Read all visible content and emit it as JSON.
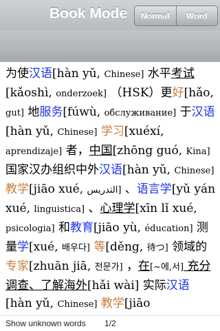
{
  "header": {
    "title": "Book Mode",
    "segments": [
      "Normal",
      "Word"
    ]
  },
  "content": {
    "tokens": [
      {
        "t": "为使",
        "c": ""
      },
      {
        "t": "汉语",
        "c": "blue"
      },
      {
        "t": "[hàn yǔ, ",
        "c": ""
      },
      {
        "t": "Chinese]",
        "c": "small"
      },
      {
        "t": " 水平",
        "c": ""
      },
      {
        "t": "考试",
        "c": "ul"
      },
      {
        "t": "[kǎoshì, ",
        "c": ""
      },
      {
        "t": "onderzoek]",
        "c": "small"
      },
      {
        "t": " （HSK）更",
        "c": ""
      },
      {
        "t": "好",
        "c": "orange"
      },
      {
        "t": "[hǎo, ",
        "c": ""
      },
      {
        "t": "gut]",
        "c": "small"
      },
      {
        "t": " 地",
        "c": ""
      },
      {
        "t": "服务",
        "c": "blue"
      },
      {
        "t": "[fúwù, ",
        "c": ""
      },
      {
        "t": "обслуживание]",
        "c": "small"
      },
      {
        "t": " 于",
        "c": ""
      },
      {
        "t": "汉语",
        "c": "blue"
      },
      {
        "t": "[hàn yǔ, ",
        "c": ""
      },
      {
        "t": "Chinese]",
        "c": "small"
      },
      {
        "t": " ",
        "c": ""
      },
      {
        "t": "学习",
        "c": "orange"
      },
      {
        "t": "[xuéxí, ",
        "c": ""
      },
      {
        "t": "aprendizaje]",
        "c": "small"
      },
      {
        "t": " 者，",
        "c": ""
      },
      {
        "t": "中国",
        "c": "ul"
      },
      {
        "t": "[zhōng guó, ",
        "c": ""
      },
      {
        "t": "Kina]",
        "c": "small"
      },
      {
        "t": " 国家汉办组织中外",
        "c": ""
      },
      {
        "t": "汉语",
        "c": "blue"
      },
      {
        "t": "[hàn yǔ, ",
        "c": ""
      },
      {
        "t": "Chinese]",
        "c": "small"
      },
      {
        "t": " ",
        "c": ""
      },
      {
        "t": "教学",
        "c": "orange"
      },
      {
        "t": "[jiāo xué, ",
        "c": ""
      },
      {
        "t": "التدريس]",
        "c": "small"
      },
      {
        "t": " 、",
        "c": ""
      },
      {
        "t": "语言学",
        "c": "blue"
      },
      {
        "t": "[yǔ yán xué, ",
        "c": ""
      },
      {
        "t": "linguistica]",
        "c": "small"
      },
      {
        "t": " 、",
        "c": ""
      },
      {
        "t": "心理学",
        "c": "ul"
      },
      {
        "t": "[xīn lǐ xué, ",
        "c": ""
      },
      {
        "t": "psicologia]",
        "c": "small"
      },
      {
        "t": " 和",
        "c": ""
      },
      {
        "t": "教育",
        "c": "blue"
      },
      {
        "t": "[jiāo yù, ",
        "c": ""
      },
      {
        "t": "éducation]",
        "c": "small"
      },
      {
        "t": " 测量",
        "c": ""
      },
      {
        "t": "学",
        "c": "blue"
      },
      {
        "t": "[xué, ",
        "c": ""
      },
      {
        "t": "배우다]",
        "c": "small"
      },
      {
        "t": " ",
        "c": ""
      },
      {
        "t": "等",
        "c": "orange"
      },
      {
        "t": "[děng, ",
        "c": ""
      },
      {
        "t": "待つ]",
        "c": "small"
      },
      {
        "t": " 领域的",
        "c": ""
      },
      {
        "t": "专家",
        "c": "orange"
      },
      {
        "t": "[zhuān jiā, ",
        "c": ""
      },
      {
        "t": "전문가]",
        "c": "small"
      },
      {
        "t": " ，",
        "c": ""
      },
      {
        "t": "在",
        "c": "ul"
      },
      {
        "t": "[~에,서]",
        "c": "small"
      },
      {
        "t": " 充分调查、",
        "c": "ul"
      },
      {
        "t": "了解海外",
        "c": "ul"
      },
      {
        "t": "[hǎi wài]",
        "c": ""
      },
      {
        "t": " 实际",
        "c": ""
      },
      {
        "t": "汉语",
        "c": "blue"
      },
      {
        "t": "[hàn yǔ, ",
        "c": ""
      },
      {
        "t": "Chinese]",
        "c": "small"
      },
      {
        "t": " ",
        "c": ""
      },
      {
        "t": "教学",
        "c": "orange"
      },
      {
        "t": "[jiāo",
        "c": ""
      }
    ]
  },
  "footer": {
    "toggle_label": "Show unknown words",
    "page_indicator": "1/2"
  }
}
